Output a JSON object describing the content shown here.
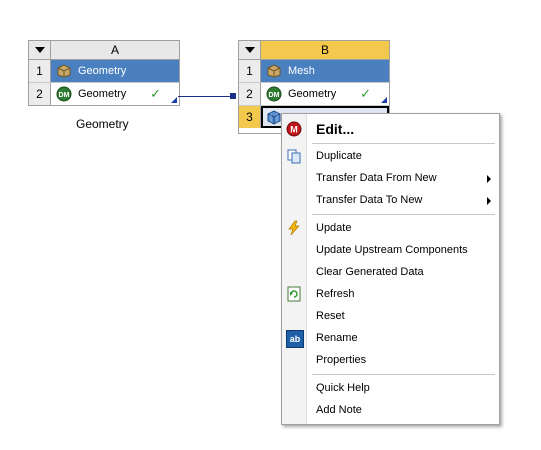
{
  "system_a": {
    "letter": "A",
    "rows": [
      {
        "num": "1",
        "label": "Geometry",
        "icon": "geometry-box-icon"
      },
      {
        "num": "2",
        "label": "Geometry",
        "icon": "dm-icon"
      }
    ],
    "caption": "Geometry"
  },
  "system_b": {
    "letter": "B",
    "rows": [
      {
        "num": "1",
        "label": "Mesh",
        "icon": "mesh-box-icon"
      },
      {
        "num": "2",
        "label": "Geometry",
        "icon": "dm-icon"
      },
      {
        "num": "3",
        "label": "",
        "icon": "mesh-cube-icon"
      }
    ]
  },
  "context_menu": {
    "items": {
      "edit": "Edit...",
      "duplicate": "Duplicate",
      "transfer_from": "Transfer Data From New",
      "transfer_to": "Transfer Data To New",
      "update": "Update",
      "update_upstream": "Update Upstream Components",
      "clear_generated": "Clear Generated Data",
      "refresh": "Refresh",
      "reset": "Reset",
      "rename": "Rename",
      "properties": "Properties",
      "quick_help": "Quick Help",
      "add_note": "Add Note"
    },
    "rename_icon_text": "ab"
  },
  "colors": {
    "title_cell": "#4a7fc0",
    "active_header": "#f2c94c",
    "link": "#1b2f8a",
    "check": "#2e9b2e"
  }
}
